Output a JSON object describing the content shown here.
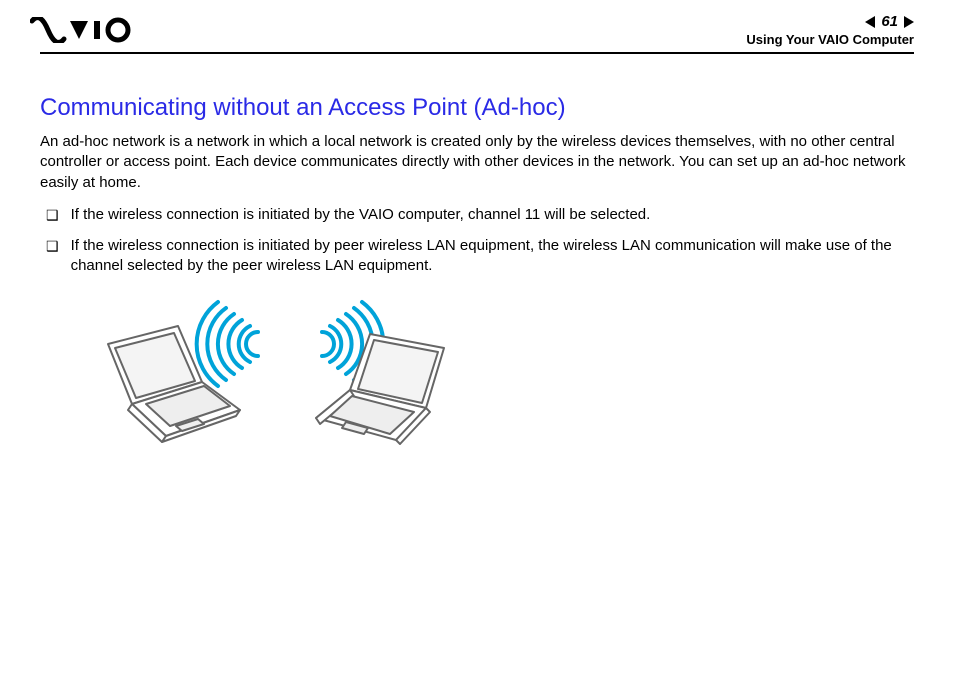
{
  "header": {
    "page_number": "61",
    "section": "Using Your VAIO Computer"
  },
  "content": {
    "title": "Communicating without an Access Point (Ad-hoc)",
    "intro": "An ad-hoc network is a network in which a local network is created only by the wireless devices themselves, with no other central controller or access point. Each device communicates directly with other devices in the network. You can set up an ad-hoc network easily at home.",
    "bullets": [
      "If the wireless connection is initiated by the VAIO computer, channel 11 will be selected.",
      "If the wireless connection is initiated by peer wireless LAN equipment, the wireless LAN communication will make use of the channel selected by the peer wireless LAN equipment."
    ]
  }
}
